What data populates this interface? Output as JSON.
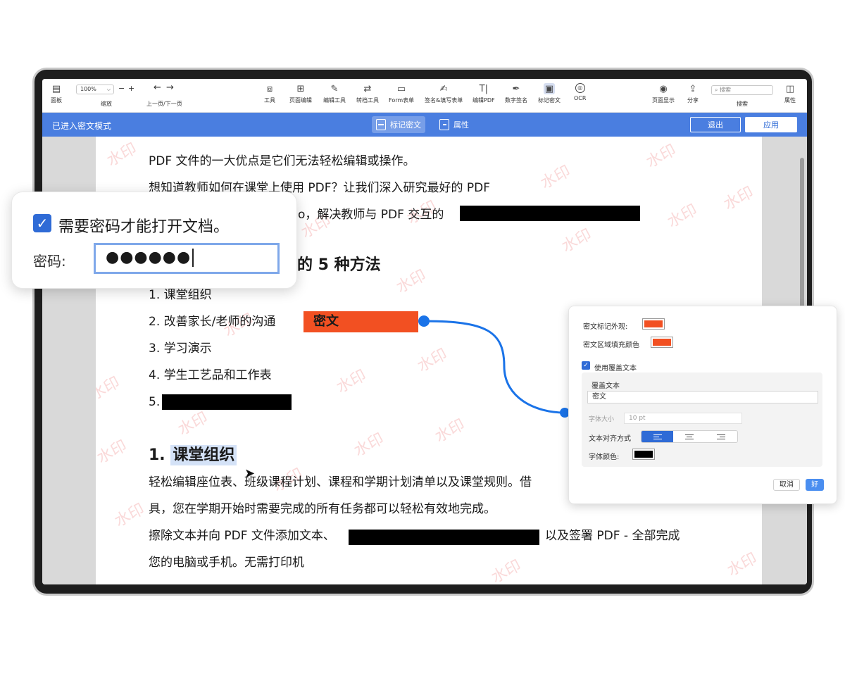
{
  "toolbar": {
    "panel": "面板",
    "zoom_value": "100%",
    "zoom_minus": "−",
    "zoom_plus": "+",
    "zoom_label": "缩放",
    "nav_label": "上一页/下一页",
    "tools": "工具",
    "page_edit": "页面编辑",
    "edit_tools": "编辑工具",
    "convert": "转档工具",
    "form": "Form表单",
    "sign_fill": "签名&填写表单",
    "edit_pdf": "编辑PDF",
    "digital_sign": "数字签名",
    "redact": "标记密文",
    "ocr": "OCR",
    "page_display": "页面显示",
    "share": "分享",
    "search_placeholder": "搜索",
    "search_label": "搜索",
    "properties": "属性"
  },
  "modebar": {
    "title": "已进入密文模式",
    "tab_redact": "标记密文",
    "tab_props": "属性",
    "exit": "退出",
    "apply": "应用"
  },
  "document": {
    "watermark": "水印",
    "line1": "PDF 文件的一大优点是它们无法轻松编辑或操作。",
    "line2": "想知道教师如何在课堂上使用 PDF？让我们深入研究最好的 PDF",
    "line3": "o，解决教师与 PDF 交互的",
    "heading_tail": "的 5 种方法",
    "item1": "1. 课堂组织",
    "item2": "2. 改善家长/老师的沟通",
    "cipher": "密文",
    "item3": "3. 学习演示",
    "item4": "4. 学生工艺品和工作表",
    "item5": "5.",
    "h1_num": "1.",
    "h1_text": "课堂组织",
    "para1": "轻松编辑座位表、班级课程计划、课程和学期计划清单以及课堂规则。借",
    "para2": "具，您在学期开始时需要完成的所有任务都可以轻松有效地完成。",
    "para3_a": "擦除文本并向 PDF 文件添加文本、",
    "para3_b": "以及签署 PDF - 全部完成",
    "para4": "您的电脑或手机。无需打印机"
  },
  "password_popup": {
    "checkbox_label": "需要密码才能打开文档。",
    "field_label": "密码:",
    "value": "●●●●●●"
  },
  "properties_panel": {
    "mark_appearance": "密文标记外观:",
    "fill_color": "密文区域填充颜色",
    "use_overlay": "使用覆盖文本",
    "overlay_text_label": "覆盖文本",
    "overlay_text_value": "密文",
    "font_size_label": "字体大小",
    "font_size_value": "10 pt",
    "align_label": "文本对齐方式",
    "font_color_label": "字体颜色:",
    "cancel": "取消",
    "ok": "好",
    "colors": {
      "mark": "#f25022",
      "fill": "#f25022",
      "font": "#000000"
    }
  },
  "colors": {
    "accent": "#4a7ee0",
    "connector": "#1a73e8"
  }
}
